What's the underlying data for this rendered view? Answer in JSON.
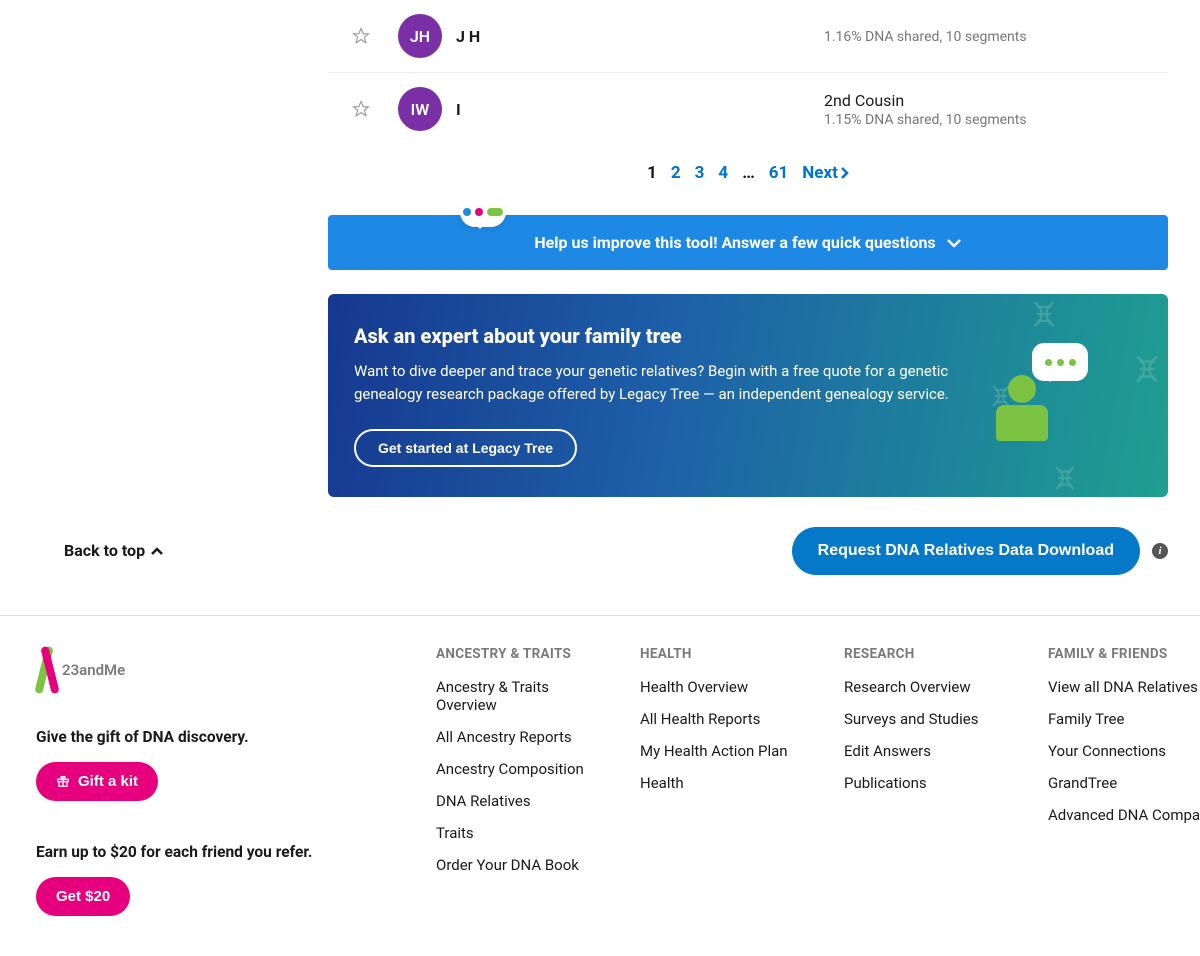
{
  "relatives": [
    {
      "initials": "JH",
      "name": "J H",
      "avatar_color": "#7b2fa6",
      "relationship": "",
      "dna": "1.16% DNA shared, 10 segments"
    },
    {
      "initials": "IW",
      "name": "I",
      "avatar_color": "#7b2fa6",
      "relationship": "2nd Cousin",
      "dna": "1.15% DNA shared, 10 segments"
    }
  ],
  "pagination": {
    "current": "1",
    "pages": [
      "2",
      "3",
      "4"
    ],
    "ellipsis": "…",
    "last": "61",
    "next_label": "Next"
  },
  "feedback": {
    "text": "Help us improve this tool! Answer a few quick questions",
    "dot_colors": [
      "#1e88e5",
      "#e6007e",
      "#7cc243"
    ]
  },
  "expert": {
    "title": "Ask an expert about your family tree",
    "desc": "Want to dive deeper and trace your genetic relatives? Begin with a free quote for a genetic genealogy research package offered by Legacy Tree — an independent genealogy service.",
    "cta": "Get started at Legacy Tree"
  },
  "back_to_top": "Back to top",
  "download_btn": "Request DNA Relatives Data Download",
  "footer": {
    "brand": "23andMe",
    "gift_heading": "Give the gift of DNA discovery.",
    "gift_btn": "Gift a kit",
    "refer_heading": "Earn up to $20 for each friend you refer.",
    "refer_btn": "Get $20",
    "columns": [
      {
        "heading": "ANCESTRY & TRAITS",
        "links": [
          "Ancestry & Traits Overview",
          "All Ancestry Reports",
          "Ancestry Composition",
          "DNA Relatives",
          "Traits",
          "Order Your DNA Book"
        ]
      },
      {
        "heading": "HEALTH",
        "links": [
          "Health Overview",
          "All Health Reports",
          "My Health Action Plan",
          "Health"
        ]
      },
      {
        "heading": "RESEARCH",
        "links": [
          "Research Overview",
          "Surveys and Studies",
          "Edit Answers",
          "Publications"
        ]
      },
      {
        "heading": "FAMILY & FRIENDS",
        "links": [
          "View all DNA Relatives",
          "Family Tree",
          "Your Connections",
          "GrandTree",
          "Advanced DNA Comparison"
        ]
      }
    ]
  }
}
